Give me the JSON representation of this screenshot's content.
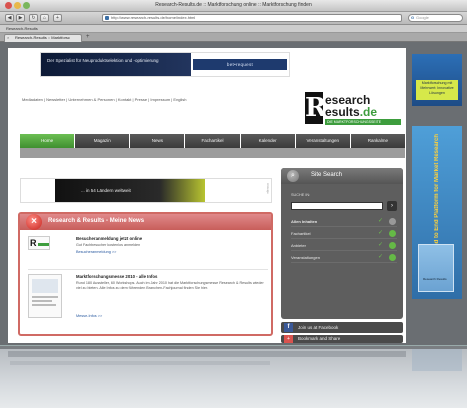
{
  "browser": {
    "window_title": "Research-Results.de :: Marktforschung online :: Marktforschung finden",
    "address": "http://www.research-results.de/home/index.html",
    "search_placeholder": "Google",
    "bookmarks_label": "Research-Results",
    "tab_label": "Research-Results :: Marktforsc",
    "new_tab": "+"
  },
  "top_banner": {
    "text": "Der Spezialist für Neuproduktselektion und -optimierung",
    "logo": "bet•request"
  },
  "meta_links": "Mediadaten  |  Newsletter  |  Unternehmen & Personen  |  Kontakt  |  Presse  |  Impressum  |  English",
  "brand": {
    "mark": "R",
    "line1": "esearch",
    "line2a": "esults",
    "line2b": ".de",
    "tagline": "DIE MARKTFORSCHUNGSSEITE"
  },
  "nav": [
    "Home",
    "Magazin",
    "News",
    "Fachartikel",
    "Kalender",
    "Veranstaltungen",
    "Rankalme"
  ],
  "mid_banner": {
    "text": "... in 54 Ländern weltweit",
    "ad": "Anzeige"
  },
  "news": {
    "title": "Research & Results - Meine News",
    "items": [
      {
        "headline": "Besucheranmeldung jetzt online",
        "body": "Gut Fachbesucher kostenlos anmelden",
        "more": "Besucheranmeldung >>"
      },
      {
        "headline": "Marktforschungsmesse 2010 - alle Infos",
        "body": "Rund 180 Aussteller, 60 Workshops. Auch im Jahr 2010 hat die Marktforschungsmesse Research & Results wieder viel zu bieten. Alle Infos zu dem führenden Branchen-Fachjournal finden Sie hier.",
        "more": "Messe-Infos >>"
      }
    ]
  },
  "site_search": {
    "title": "Site Search",
    "label": "SUCHE IN:",
    "go": "›",
    "rows": [
      {
        "label": "Allen Inhalten",
        "dot": "gray"
      },
      {
        "label": "Fachartikel",
        "dot": "green"
      },
      {
        "label": "Anbieter",
        "dot": "green"
      },
      {
        "label": "Veranstaltungen",
        "dot": "green"
      }
    ]
  },
  "facebook": {
    "icon": "f",
    "label": "Join us at Facebook"
  },
  "bookmark": {
    "label": "Bookmark and Share"
  },
  "ad_right_top": {
    "text": "Marktforschung mit Mehrwert: Innovative Lösungen"
  },
  "ad_right": {
    "vertical_text": "The End to End Platform for Market Research",
    "cover_label": "Research Results"
  },
  "colors": {
    "accent_green": "#3d9d3d",
    "news_red": "#c85e5a",
    "nav_dark": "#444444"
  }
}
